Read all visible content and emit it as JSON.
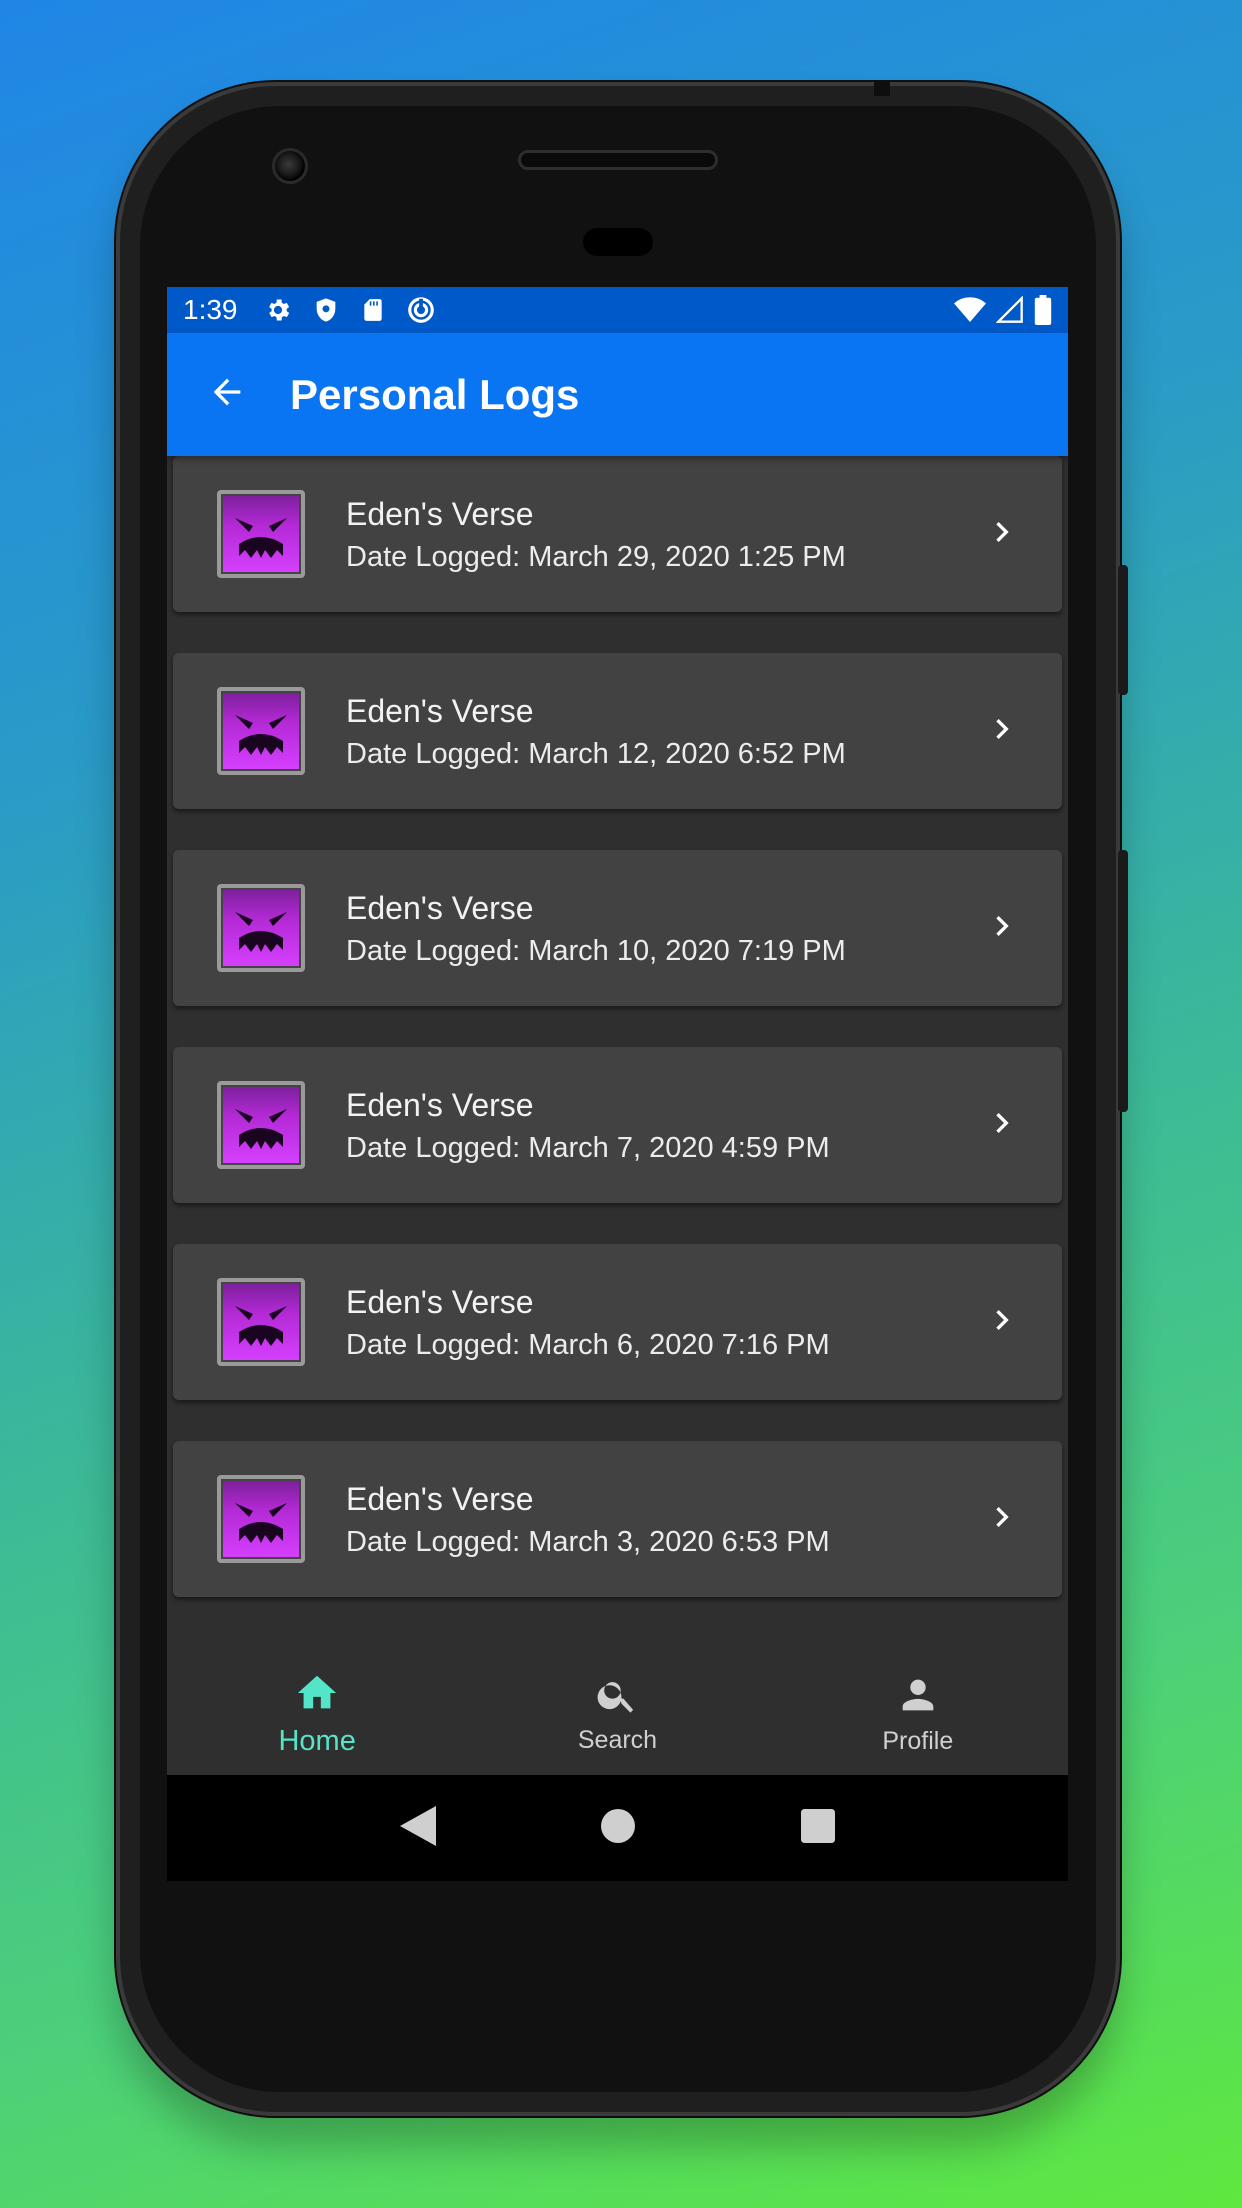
{
  "status_bar": {
    "time": "1:39"
  },
  "app_bar": {
    "title": "Personal Logs"
  },
  "logs": [
    {
      "title": "Eden's Verse",
      "subtitle": "Date Logged: March 29, 2020 1:25 PM"
    },
    {
      "title": "Eden's Verse",
      "subtitle": "Date Logged: March 12, 2020 6:52 PM"
    },
    {
      "title": "Eden's Verse",
      "subtitle": "Date Logged: March 10, 2020 7:19 PM"
    },
    {
      "title": "Eden's Verse",
      "subtitle": "Date Logged: March 7, 2020 4:59 PM"
    },
    {
      "title": "Eden's Verse",
      "subtitle": "Date Logged: March 6, 2020 7:16 PM"
    },
    {
      "title": "Eden's Verse",
      "subtitle": "Date Logged: March 3, 2020 6:53 PM"
    }
  ],
  "bottom_nav": {
    "items": [
      {
        "label": "Home",
        "icon": "home-icon",
        "active": true
      },
      {
        "label": "Search",
        "icon": "search-icon",
        "active": false
      },
      {
        "label": "Profile",
        "icon": "person-icon",
        "active": false
      }
    ]
  },
  "colors": {
    "app_bar": "#0a75f2",
    "status_bar": "#0059c9",
    "active_nav": "#54e5c8",
    "card": "#424242",
    "background": "#2f2f2f"
  }
}
